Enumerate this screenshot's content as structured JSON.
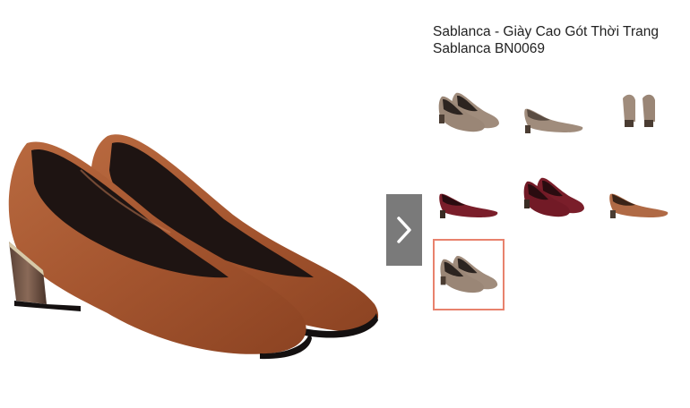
{
  "product": {
    "title": "Sablanca - Giày Cao Gót Thời Trang Sablanca BN0069"
  },
  "gallery": {
    "next_icon": "chevron-right-icon",
    "selected_index": 6,
    "thumbnails": [
      {
        "color": "taupe",
        "view": "pair-angle"
      },
      {
        "color": "taupe",
        "view": "side"
      },
      {
        "color": "taupe",
        "view": "back"
      },
      {
        "color": "burgundy",
        "view": "side"
      },
      {
        "color": "burgundy",
        "view": "pair-angle"
      },
      {
        "color": "cognac",
        "view": "side"
      },
      {
        "color": "taupe",
        "view": "pair-angle"
      }
    ]
  },
  "colors": {
    "accent_border": "#e8826d",
    "arrow_bg": "#7a7a7a",
    "shoe_main": "#a85a35"
  }
}
